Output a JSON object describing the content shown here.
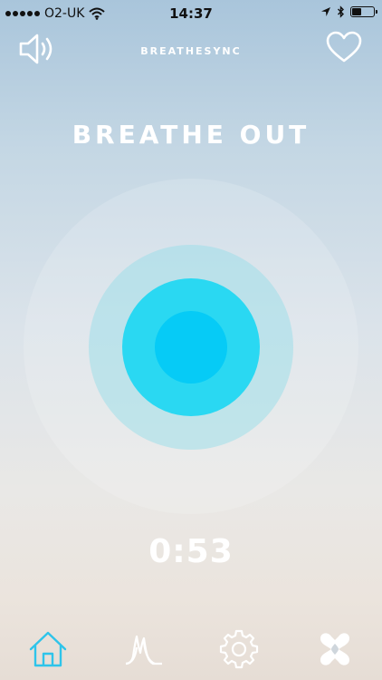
{
  "status_bar": {
    "carrier": "O2-UK",
    "time": "14:37",
    "icons": [
      "signal-dots-icon",
      "wifi-icon",
      "location-arrow-icon",
      "bluetooth-icon",
      "battery-icon"
    ]
  },
  "header": {
    "app_title": "BREATHESYNC",
    "left_icon": "speaker-icon",
    "right_icon": "heart-icon"
  },
  "main": {
    "instruction": "BREATHE OUT",
    "timer": "0:53"
  },
  "colors": {
    "accent": "#2ad8f2",
    "core": "#06cbf6",
    "tab_active": "#2ec4ea",
    "icon_white": "#ffffff"
  },
  "tabbar": {
    "active_tab": "home",
    "tabs": [
      {
        "id": "home",
        "icon": "home-icon"
      },
      {
        "id": "stats",
        "icon": "pulse-chart-icon"
      },
      {
        "id": "settings",
        "icon": "gear-icon"
      },
      {
        "id": "brand",
        "icon": "heart-logo-icon"
      }
    ]
  }
}
